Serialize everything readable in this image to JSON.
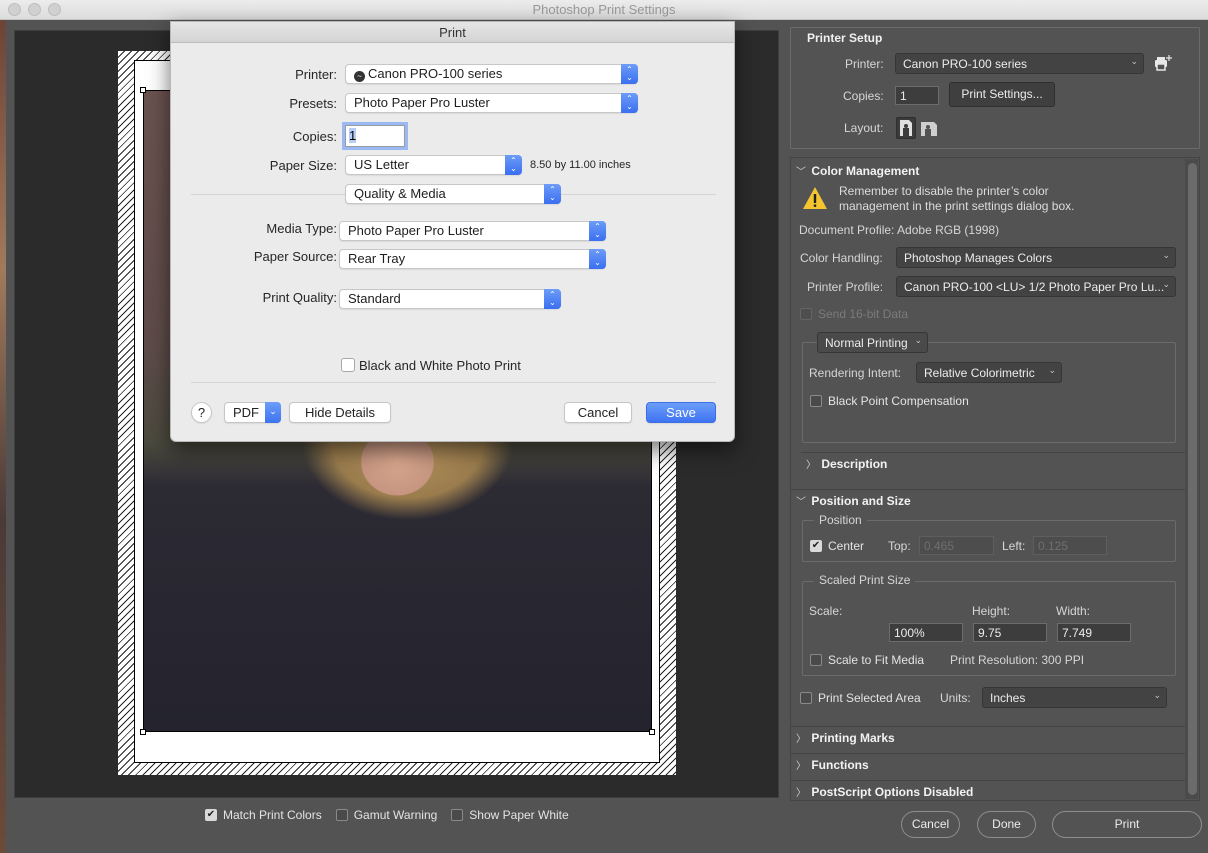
{
  "window": {
    "title": "Photoshop Print Settings"
  },
  "preview": {
    "options": [
      {
        "label": "Match Print Colors",
        "checked": true
      },
      {
        "label": "Gamut Warning",
        "checked": false
      },
      {
        "label": "Show Paper White",
        "checked": false
      }
    ]
  },
  "print_dialog": {
    "title": "Print",
    "printer_label": "Printer:",
    "printer_value": "Canon PRO-100 series",
    "presets_label": "Presets:",
    "presets_value": "Photo Paper Pro Luster",
    "copies_label": "Copies:",
    "copies_value": "1",
    "paper_size_label": "Paper Size:",
    "paper_size_value": "US Letter",
    "paper_size_dims": "8.50 by 11.00 inches",
    "section_value": "Quality & Media",
    "media_type_label": "Media Type:",
    "media_type_value": "Photo Paper Pro Luster",
    "paper_source_label": "Paper Source:",
    "paper_source_value": "Rear Tray",
    "print_quality_label": "Print Quality:",
    "print_quality_value": "Standard",
    "bw_label": "Black and White Photo Print",
    "bw_checked": false,
    "help_label": "?",
    "pdf_label": "PDF",
    "hide_details_label": "Hide Details",
    "cancel_label": "Cancel",
    "save_label": "Save",
    "accent_color": "#3e73f1"
  },
  "printer_setup": {
    "heading": "Printer Setup",
    "printer_label": "Printer:",
    "printer_value": "Canon PRO-100 series",
    "copies_label": "Copies:",
    "copies_value": "1",
    "print_settings_label": "Print Settings...",
    "layout_label": "Layout:"
  },
  "color_management": {
    "heading": "Color Management",
    "warning_line1": "Remember to disable the printer’s color",
    "warning_line2": "management in the print settings dialog box.",
    "document_profile": "Document Profile: Adobe RGB (1998)",
    "color_handling_label": "Color Handling:",
    "color_handling_value": "Photoshop Manages Colors",
    "printer_profile_label": "Printer Profile:",
    "printer_profile_value": "Canon PRO-100 <LU> 1/2 Photo Paper Pro Lu...",
    "send16_label": "Send 16-bit Data",
    "mode_value": "Normal Printing",
    "rendering_intent_label": "Rendering Intent:",
    "rendering_intent_value": "Relative Colorimetric",
    "bpc_label": "Black Point Compensation",
    "bpc_checked": false
  },
  "description": {
    "heading": "Description"
  },
  "position_size": {
    "heading": "Position and Size",
    "position_legend": "Position",
    "center_label": "Center",
    "center_checked": true,
    "top_label": "Top:",
    "top_value": "0.465",
    "left_label": "Left:",
    "left_value": "0.125",
    "scaled_legend": "Scaled Print Size",
    "scale_label": "Scale:",
    "height_label": "Height:",
    "width_label": "Width:",
    "scale_value": "100%",
    "height_value": "9.75",
    "width_value": "7.749",
    "fit_label": "Scale to Fit Media",
    "fit_checked": false,
    "resolution": "Print Resolution: 300 PPI",
    "print_selected_label": "Print Selected Area",
    "print_selected_checked": false,
    "units_label": "Units:",
    "units_value": "Inches"
  },
  "collapsed_sections": [
    "Printing Marks",
    "Functions",
    "PostScript Options Disabled"
  ],
  "footer": {
    "cancel_label": "Cancel",
    "done_label": "Done",
    "print_label": "Print"
  }
}
